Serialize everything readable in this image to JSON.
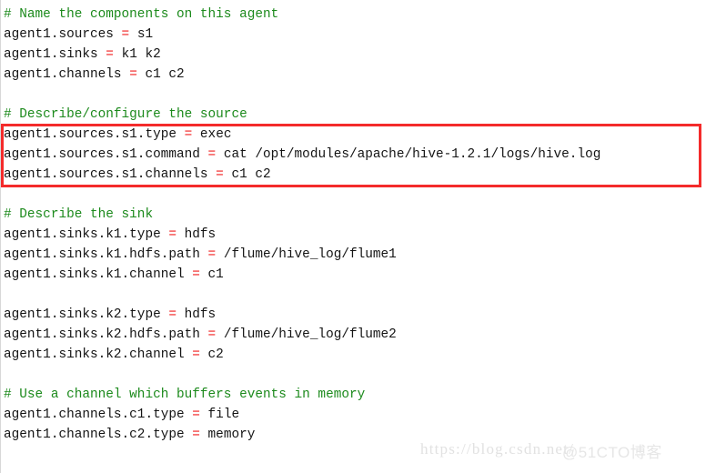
{
  "editor": {
    "background_color": "#ffffff",
    "comment_color": "#1c8a1c",
    "text_color": "#141414",
    "operator_color": "#f02020",
    "highlight_color": "#f42b2b",
    "lines": [
      {
        "type": "comment",
        "text": "# Name the components on this agent"
      },
      {
        "type": "config",
        "key": "agent1.sources",
        "eq": "=",
        "value": "s1"
      },
      {
        "type": "config",
        "key": "agent1.sinks",
        "eq": "=",
        "value": "k1 k2"
      },
      {
        "type": "config",
        "key": "agent1.channels",
        "eq": "=",
        "value": "c1 c2"
      },
      {
        "type": "blank",
        "text": ""
      },
      {
        "type": "comment",
        "text": "# Describe/configure the source"
      },
      {
        "type": "config",
        "key": "agent1.sources.s1.type",
        "eq": "=",
        "value": "exec"
      },
      {
        "type": "config",
        "key": "agent1.sources.s1.command",
        "eq": "=",
        "value": "cat /opt/modules/apache/hive-1.2.1/logs/hive.log"
      },
      {
        "type": "config",
        "key": "agent1.sources.s1.channels",
        "eq": "=",
        "value": "c1 c2"
      },
      {
        "type": "blank",
        "text": ""
      },
      {
        "type": "comment",
        "text": "# Describe the sink"
      },
      {
        "type": "config",
        "key": "agent1.sinks.k1.type",
        "eq": "=",
        "value": "hdfs"
      },
      {
        "type": "config",
        "key": "agent1.sinks.k1.hdfs.path",
        "eq": "=",
        "value": "/flume/hive_log/flume1"
      },
      {
        "type": "config",
        "key": "agent1.sinks.k1.channel",
        "eq": "=",
        "value": "c1"
      },
      {
        "type": "blank",
        "text": ""
      },
      {
        "type": "config",
        "key": "agent1.sinks.k2.type",
        "eq": "=",
        "value": "hdfs"
      },
      {
        "type": "config",
        "key": "agent1.sinks.k2.hdfs.path",
        "eq": "=",
        "value": "/flume/hive_log/flume2"
      },
      {
        "type": "config",
        "key": "agent1.sinks.k2.channel",
        "eq": "=",
        "value": "c2"
      },
      {
        "type": "blank",
        "text": ""
      },
      {
        "type": "comment",
        "text": "# Use a channel which buffers events in memory"
      },
      {
        "type": "config",
        "key": "agent1.channels.c1.type",
        "eq": "=",
        "value": "file"
      },
      {
        "type": "config",
        "key": "agent1.channels.c2.type",
        "eq": "=",
        "value": "memory"
      }
    ]
  },
  "annotation": {
    "name": "source-block-highlight",
    "covers_lines": [
      6,
      7,
      8
    ]
  },
  "watermark": {
    "url": "https://blog.csdn.net/",
    "handle": "@51CTO博客"
  }
}
